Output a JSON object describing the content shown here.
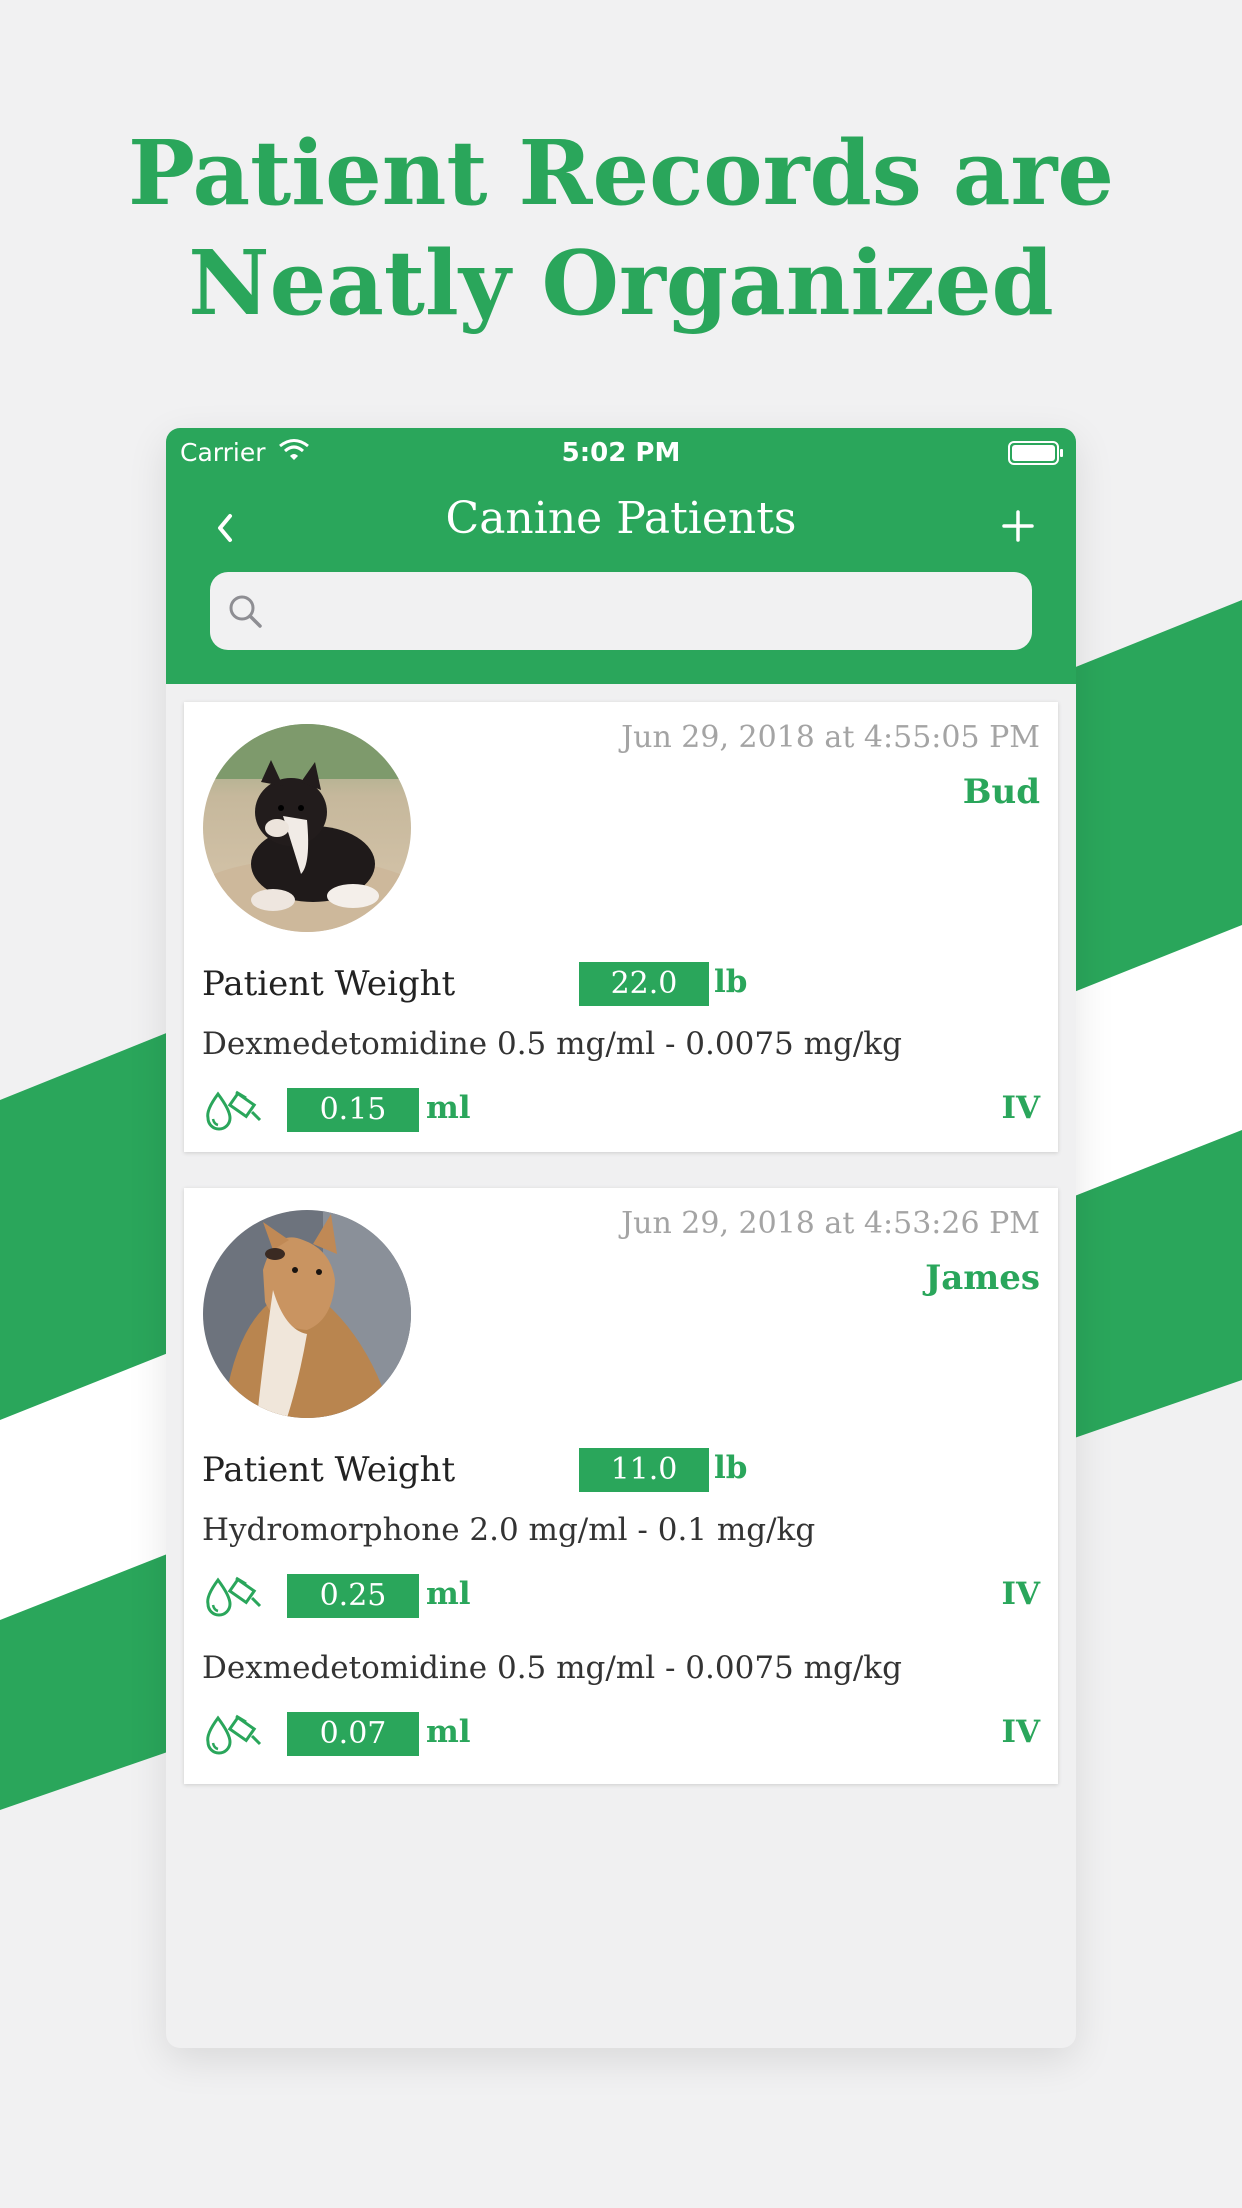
{
  "headline": {
    "line1": "Patient Records are",
    "line2": "Neatly Organized"
  },
  "colors": {
    "brand_green": "#2aa65b",
    "background": "#f1f1f2"
  },
  "status_bar": {
    "carrier": "Carrier",
    "time": "5:02 PM"
  },
  "nav": {
    "title": "Canine Patients",
    "back_icon": "chevron-left-icon",
    "add_icon": "plus-icon"
  },
  "search": {
    "placeholder": "",
    "icon": "search-icon"
  },
  "patients": [
    {
      "date": "Jun 29, 2018 at 4:55:05 PM",
      "name": "Bud",
      "weight_label": "Patient Weight",
      "weight": "22.0",
      "weight_unit": "lb",
      "photo": "black-white-puppy-on-sand",
      "medications": [
        {
          "drug": "Dexmedetomidine 0.5 mg/ml - 0.0075 mg/kg",
          "dose": "0.15",
          "unit": "ml",
          "route": "IV"
        }
      ]
    },
    {
      "date": "Jun 29, 2018 at 4:53:26 PM",
      "name": "James",
      "weight_label": "Patient Weight",
      "weight": "11.0",
      "weight_unit": "lb",
      "photo": "tan-senior-dog",
      "medications": [
        {
          "drug": "Hydromorphone 2.0 mg/ml - 0.1 mg/kg",
          "dose": "0.25",
          "unit": "ml",
          "route": "IV"
        },
        {
          "drug": "Dexmedetomidine 0.5 mg/ml - 0.0075 mg/kg",
          "dose": "0.07",
          "unit": "ml",
          "route": "IV"
        }
      ]
    }
  ]
}
